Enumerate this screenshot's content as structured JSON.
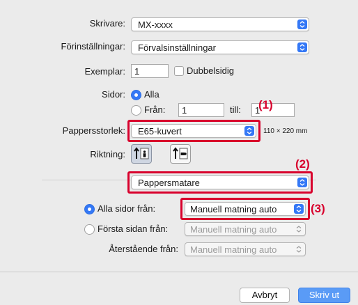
{
  "printer": {
    "label": "Skrivare:",
    "value": "MX-xxxx"
  },
  "presets": {
    "label": "Förinställningar:",
    "value": "Förvalsinställningar"
  },
  "copies": {
    "label": "Exemplar:",
    "value": "1",
    "duplex_label": "Dubbelsidig",
    "duplex_checked": false
  },
  "pages": {
    "label": "Sidor:",
    "all_label": "Alla",
    "from_label": "Från:",
    "from_value": "1",
    "to_label": "till:",
    "to_value": "1",
    "selected": "all"
  },
  "paper_size": {
    "label": "Pappersstorlek:",
    "value": "E65-kuvert",
    "dimensions": "110 × 220 mm"
  },
  "orientation": {
    "label": "Riktning:",
    "selected": "portrait"
  },
  "section": {
    "value": "Pappersmatare"
  },
  "feed": {
    "all_pages": {
      "label": "Alla sidor från:",
      "value": "Manuell matning auto",
      "selected": true
    },
    "first_page": {
      "label": "Första sidan från:",
      "value": "Manuell matning auto",
      "selected": false
    },
    "remaining": {
      "label": "Återstående från:",
      "value": "Manuell matning auto"
    }
  },
  "callouts": {
    "c1": "(1)",
    "c2": "(2)",
    "c3": "(3)"
  },
  "buttons": {
    "cancel": "Avbryt",
    "print": "Skriv ut"
  },
  "colors": {
    "accent": "#3478f6",
    "callout": "#d8002c",
    "background": "#ebebeb"
  },
  "icons": [
    "chevron-updown-icon",
    "portrait-orientation-icon",
    "landscape-orientation-icon",
    "radio-icon",
    "checkbox-icon"
  ]
}
